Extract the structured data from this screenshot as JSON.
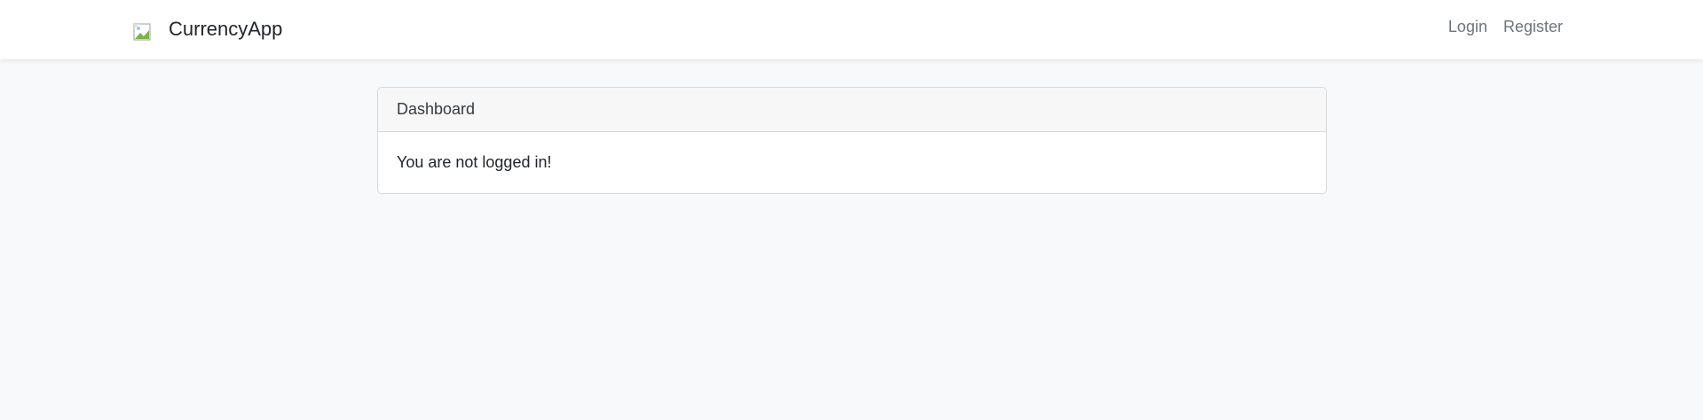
{
  "navbar": {
    "brand_icon": "broken-image-icon",
    "brand_name": "CurrencyApp",
    "links": {
      "login": "Login",
      "register": "Register"
    }
  },
  "card": {
    "header": "Dashboard",
    "message": "You are not logged in!"
  },
  "colors": {
    "page_background": "#f8f9fa",
    "navbar_background": "#ffffff",
    "nav_link": "#6c757d",
    "card_header_background": "#f7f7f7",
    "card_border": "#d6d8db"
  }
}
